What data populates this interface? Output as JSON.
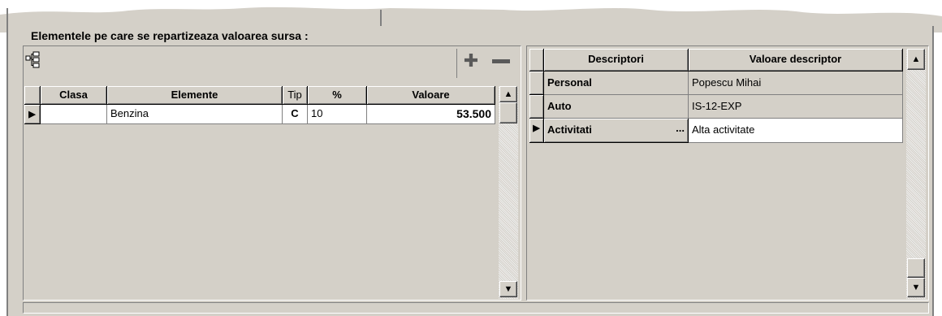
{
  "section_title": "Elementele pe care se repartizeaza valoarea sursa  :",
  "left_grid": {
    "columns": [
      "Clasa",
      "Elemente",
      "Tip",
      "%",
      "Valoare"
    ],
    "rows": [
      {
        "clasa": "",
        "elemente": "Benzina",
        "tip": "C",
        "procent": "10",
        "valoare": "53.500"
      }
    ],
    "add_glyph": "✚",
    "remove_glyph": "▬"
  },
  "right_grid": {
    "columns": [
      "Descriptori",
      "Valoare descriptor"
    ],
    "rows": [
      {
        "descriptor": "Personal",
        "valoare": "Popescu Mihai"
      },
      {
        "descriptor": "Auto",
        "valoare": "IS-12-EXP"
      },
      {
        "descriptor": "Activitati",
        "valoare": "Alta activitate",
        "ellipsis": "..."
      }
    ]
  },
  "icons": {
    "up": "▲",
    "down": "▼",
    "row_pointer": "▶"
  },
  "colors": {
    "face": "#d4d0c8",
    "plus": "#5a5a5a"
  }
}
